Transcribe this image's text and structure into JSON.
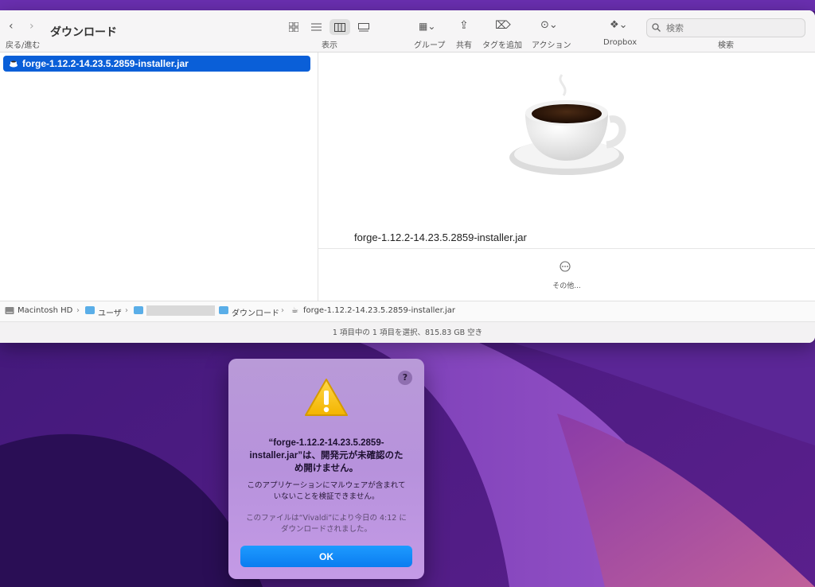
{
  "window": {
    "title": "ダウンロード",
    "nav_label": "戻る/進む",
    "view_label": "表示",
    "group_label": "グループ",
    "share_label": "共有",
    "tag_label": "タグを追加",
    "action_label": "アクション",
    "dropbox_label": "Dropbox",
    "search_label": "検索",
    "search_placeholder": "検索"
  },
  "file_list": [
    {
      "name": "forge-1.12.2-14.23.5.2859-installer.jar",
      "selected": true
    }
  ],
  "preview": {
    "filename": "forge-1.12.2-14.23.5.2859-installer.jar",
    "more_label": "その他..."
  },
  "path_bar": {
    "disk": "Macintosh HD",
    "users": "ユーザ",
    "downloads": "ダウンロード",
    "file": "forge-1.12.2-14.23.5.2859-installer.jar"
  },
  "status_bar": {
    "text": "1 項目中の 1 項目を選択、815.83 GB 空き"
  },
  "alert": {
    "help": "?",
    "title_line1": "“forge-1.12.2-14.23.5.2859-",
    "title_line2": "installer.jar”は、開発元が未確認のた",
    "title_line3": "め開けません。",
    "message_line1": "このアプリケーションにマルウェアが含まれて",
    "message_line2": "いないことを検証できません。",
    "info_line1": "このファイルは“Vivaldi”により今日の 4:12 に",
    "info_line2": "ダウンロードされました。",
    "ok_label": "OK"
  },
  "colors": {
    "selection": "#0a5fd8",
    "ok_button": "#0a7cf0",
    "alert_bg": "#b792dc",
    "wallpaper": "#3a1670"
  }
}
